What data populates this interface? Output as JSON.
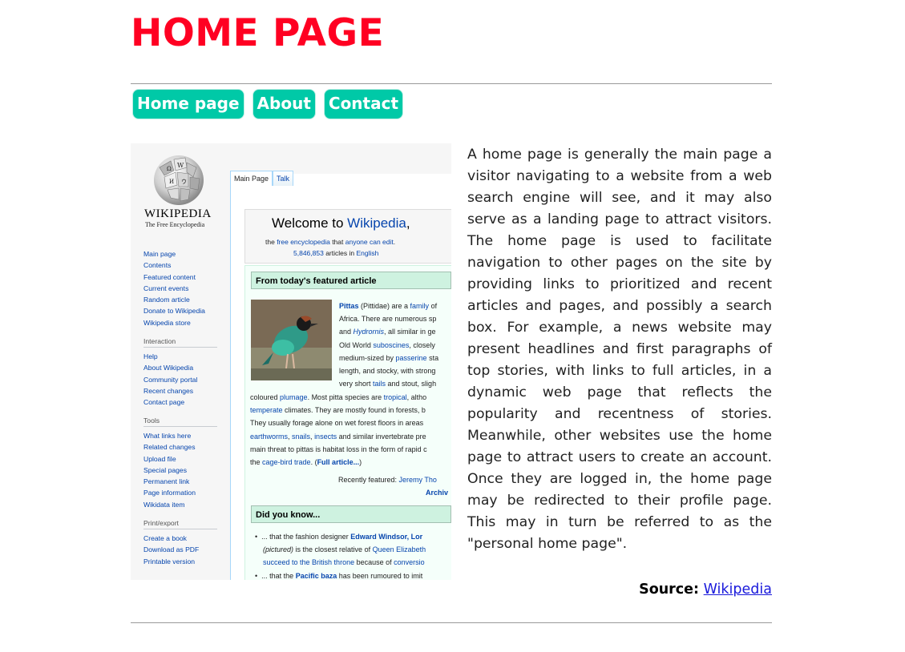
{
  "page": {
    "title": "HOME PAGE"
  },
  "nav": [
    {
      "label": "Home page"
    },
    {
      "label": "About"
    },
    {
      "label": "Contact"
    }
  ],
  "article": {
    "text": "A home page is generally the main page a visitor navigating to a website from a web search engine will see, and it may also serve as a landing page to attract visitors. The home page is used to facilitate navigation to other pages on the site by providing links to prioritized and recent articles and pages, and possibly a search box. For example, a news website may present headlines and first paragraphs of top stories, with links to full articles, in a dynamic web page that reflects the popularity and recentness of stories. Meanwhile, other websites use the home page to attract users to create an account. Once they are logged in, the home page may be redirected to their profile page. This may in turn be referred to as the \"personal home page\"."
  },
  "source": {
    "label": "Source:",
    "link": "Wikipedia"
  },
  "screenshot": {
    "brand": "WIKIPEDIA",
    "tagline": "The Free Encyclopedia",
    "nav_links": [
      "Main page",
      "Contents",
      "Featured content",
      "Current events",
      "Random article",
      "Donate to Wikipedia",
      "Wikipedia store"
    ],
    "interaction_head": "Interaction",
    "interaction_links": [
      "Help",
      "About Wikipedia",
      "Community portal",
      "Recent changes",
      "Contact page"
    ],
    "tools_head": "Tools",
    "tools_links": [
      "What links here",
      "Related changes",
      "Upload file",
      "Special pages",
      "Permanent link",
      "Page information",
      "Wikidata item"
    ],
    "print_head": "Print/export",
    "print_links": [
      "Create a book",
      "Download as PDF",
      "Printable version"
    ],
    "tab_main": "Main Page",
    "tab_talk": "Talk",
    "welcome_prefix": "Welcome to ",
    "welcome_link": "Wikipedia",
    "welcome_suffix": ",",
    "welcome_sub_a": "the ",
    "welcome_sub_link1": "free encyclopedia",
    "welcome_sub_b": " that ",
    "welcome_sub_link2": "anyone can edit",
    "welcome_sub_c": ".",
    "article_count": "5,846,853",
    "articles_in": " articles in ",
    "language": "English",
    "featured_head": "From today's featured article",
    "dyk_head": "Did you know...",
    "recently_featured": "Recently featured: ",
    "recently_link": "Jeremy Tho",
    "archive": "Archiv"
  }
}
